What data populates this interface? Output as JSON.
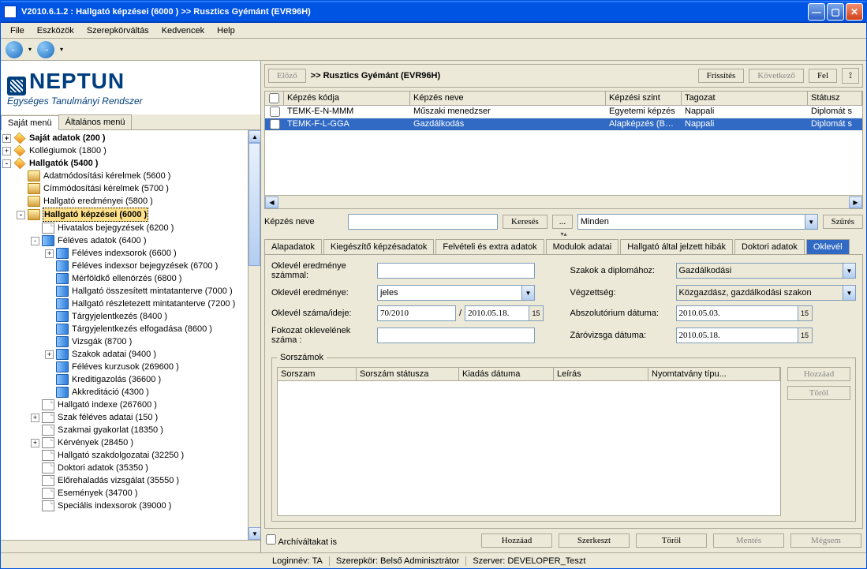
{
  "window": {
    "title": "V2010.6.1.2 : Hallgató képzései (6000  )   >> Rusztics Gyémánt (EVR96H)"
  },
  "menubar": [
    "File",
    "Eszközök",
    "Szerepkörváltás",
    "Kedvencek",
    "Help"
  ],
  "logo": {
    "brand": "NEPTUN",
    "sub": "Egységes Tanulmányi Rendszer"
  },
  "side_tabs": {
    "a": "Saját menü",
    "b": "Általános menü"
  },
  "tree": [
    {
      "pad": 0,
      "exp": "+",
      "ic": "diamond",
      "bold": true,
      "label": "Saját adatok (200  )"
    },
    {
      "pad": 0,
      "exp": "+",
      "ic": "diamond",
      "label": "Kollégiumok (1800  )"
    },
    {
      "pad": 0,
      "exp": "-",
      "ic": "diamond",
      "bold": true,
      "label": "Hallgatók (5400  )"
    },
    {
      "pad": 1,
      "exp": "",
      "ic": "folder",
      "label": "Adatmódosítási kérelmek (5600  )"
    },
    {
      "pad": 1,
      "exp": "",
      "ic": "folder",
      "label": "Címmódosítási kérelmek (5700  )"
    },
    {
      "pad": 1,
      "exp": "",
      "ic": "folder",
      "label": "Hallgató eredményei (5800  )"
    },
    {
      "pad": 1,
      "exp": "-",
      "ic": "folder",
      "bold": true,
      "sel": true,
      "label": "Hallgató képzései (6000  )"
    },
    {
      "pad": 2,
      "exp": "",
      "ic": "page",
      "label": "Hivatalos bejegyzések (6200  )"
    },
    {
      "pad": 2,
      "exp": "-",
      "ic": "book",
      "label": "Féléves adatok (6400  )"
    },
    {
      "pad": 3,
      "exp": "+",
      "ic": "book",
      "label": "Féléves indexsorok (6600  )"
    },
    {
      "pad": 3,
      "exp": "",
      "ic": "book",
      "label": "Féléves indexsor bejegyzések (6700  )"
    },
    {
      "pad": 3,
      "exp": "",
      "ic": "book",
      "label": "Mérföldkő ellenörzés (6800  )"
    },
    {
      "pad": 3,
      "exp": "",
      "ic": "book",
      "label": "Hallgató összesített mintatanterve (7000  )"
    },
    {
      "pad": 3,
      "exp": "",
      "ic": "book",
      "label": "Hallgató részletezett mintatanterve (7200  )"
    },
    {
      "pad": 3,
      "exp": "",
      "ic": "book",
      "label": "Tárgyjelentkezés (8400  )"
    },
    {
      "pad": 3,
      "exp": "",
      "ic": "book",
      "label": "Tárgyjelentkezés elfogadása (8600  )"
    },
    {
      "pad": 3,
      "exp": "",
      "ic": "book",
      "label": "Vizsgák (8700  )"
    },
    {
      "pad": 3,
      "exp": "+",
      "ic": "book",
      "label": "Szakok adatai (9400  )"
    },
    {
      "pad": 3,
      "exp": "",
      "ic": "book",
      "label": "Féléves kurzusok (269600  )"
    },
    {
      "pad": 3,
      "exp": "",
      "ic": "book",
      "label": "Kreditigazolás (36600  )"
    },
    {
      "pad": 3,
      "exp": "",
      "ic": "book",
      "label": "Akkreditáció (4300  )"
    },
    {
      "pad": 2,
      "exp": "",
      "ic": "page",
      "label": "Hallgató indexe (267600  )"
    },
    {
      "pad": 2,
      "exp": "+",
      "ic": "page",
      "label": "Szak féléves adatai (150  )"
    },
    {
      "pad": 2,
      "exp": "",
      "ic": "page",
      "label": "Szakmai gyakorlat (18350  )"
    },
    {
      "pad": 2,
      "exp": "+",
      "ic": "page",
      "label": "Kérvények (28450  )"
    },
    {
      "pad": 2,
      "exp": "",
      "ic": "page",
      "label": "Hallgató szakdolgozatai (32250  )"
    },
    {
      "pad": 2,
      "exp": "",
      "ic": "page",
      "label": "Doktori adatok (35350  )"
    },
    {
      "pad": 2,
      "exp": "",
      "ic": "page",
      "label": "Előrehaladás vizsgálat (35550  )"
    },
    {
      "pad": 2,
      "exp": "",
      "ic": "page",
      "label": "Események (34700  )"
    },
    {
      "pad": 2,
      "exp": "",
      "ic": "page",
      "label": "Speciális indexsorok (39000  )"
    }
  ],
  "hdr": {
    "prev": "Előző",
    "title": ">> Rusztics Gyémánt (EVR96H)",
    "refresh": "Frissítés",
    "next": "Következő",
    "up": "Fel"
  },
  "grid": {
    "cols": [
      "Képzés kódja",
      "Képzés neve",
      "Képzési szint",
      "Tagozat",
      "Státusz"
    ],
    "rows": [
      {
        "c": [
          "TEMK-E-N-MMM",
          "Műszaki menedzser",
          "Egyetemi képzés",
          "Nappali",
          "Diplomát s"
        ]
      },
      {
        "c": [
          "TEMK-F-L-GGA",
          "Gazdálkodás",
          "Alapképzés (BA/BSc",
          "Nappali",
          "Diplomát s"
        ],
        "sel": true
      }
    ]
  },
  "filter": {
    "label": "Képzés neve",
    "search": "Keresés",
    "all": "Minden",
    "filterbtn": "Szűrés",
    "dots": "..."
  },
  "tabs": [
    "Alapadatok",
    "Kiegészítő képzésadatok",
    "Felvételi és extra adatok",
    "Modulok adatai",
    "Hallgató által jelzett hibák",
    "Doktori adatok",
    "Oklevél"
  ],
  "form": {
    "l_eredm_szam": "Oklevél eredménye számmal:",
    "l_eredm": "Oklevél eredménye:",
    "v_eredm": "jeles",
    "l_szam": "Oklevél száma/ideje:",
    "v_szam": "70/2010",
    "v_szam_d": "2010.05.18.",
    "l_fok": "Fokozat oklevelének száma :",
    "l_szak": "Szakok a diplomához:",
    "v_szak": "Gazdálkodási",
    "l_vegz": "Végzettség:",
    "v_vegz": "Közgazdász, gazdálkodási szakon",
    "l_absz": "Abszolutórium dátuma:",
    "v_absz": "2010.05.03.",
    "l_zaro": "Záróvizsga dátuma:",
    "v_zaro": "2010.05.18."
  },
  "fieldset": {
    "legend": "Sorszámok",
    "cols": [
      "Sorszam",
      "Sorszám státusza",
      "Kiadás dátuma",
      "Leírás",
      "Nyomtatvány típu..."
    ],
    "add": "Hozzáad",
    "del": "Töröl"
  },
  "bottom": {
    "arch": "Archíváltakat is",
    "add": "Hozzáad",
    "edit": "Szerkeszt",
    "del": "Töröl",
    "save": "Mentés",
    "cancel": "Mégsem"
  },
  "status": {
    "login": "Loginnév: TA",
    "role": "Szerepkör: Belső Adminisztrátor",
    "server": "Szerver: DEVELOPER_Teszt"
  }
}
